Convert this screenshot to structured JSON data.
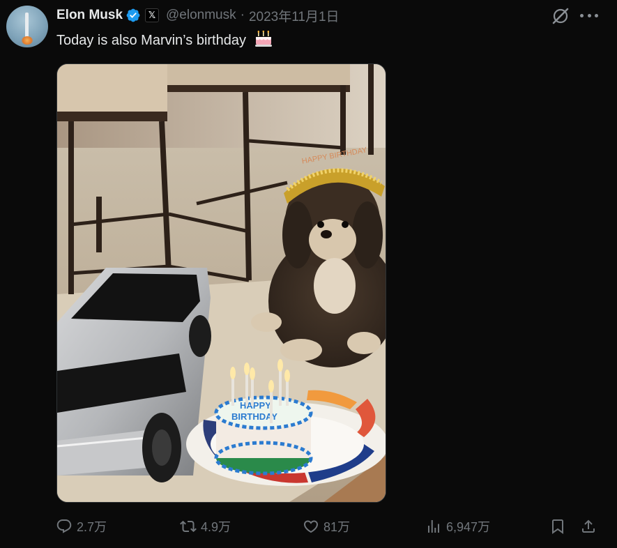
{
  "author": {
    "name": "Elon Musk",
    "handle": "@elonmusk",
    "separator": "·",
    "date": "2023年11月1日"
  },
  "tweet": {
    "text": "Today is also Marvin’s birthday"
  },
  "media": {
    "cake_lettering": [
      "HAPPY",
      "BIRTHDAY"
    ],
    "hat_lettering": "HAPPY BIRTHDAY"
  },
  "actions": {
    "replies": "2.7万",
    "retweets": "4.9万",
    "likes": "81万",
    "views": "6,947万"
  },
  "icons": {
    "verified": "verified-badge-icon",
    "affiliate": "x-logo-icon",
    "grok": "grok-icon",
    "more": "more-icon",
    "reply": "reply-icon",
    "retweet": "retweet-icon",
    "like": "heart-icon",
    "views": "views-icon",
    "bookmark": "bookmark-icon",
    "share": "share-icon"
  },
  "colors": {
    "background": "#0a0a0a",
    "text": "#e7e9ea",
    "muted": "#71767b",
    "verified": "#1d9bf0"
  }
}
